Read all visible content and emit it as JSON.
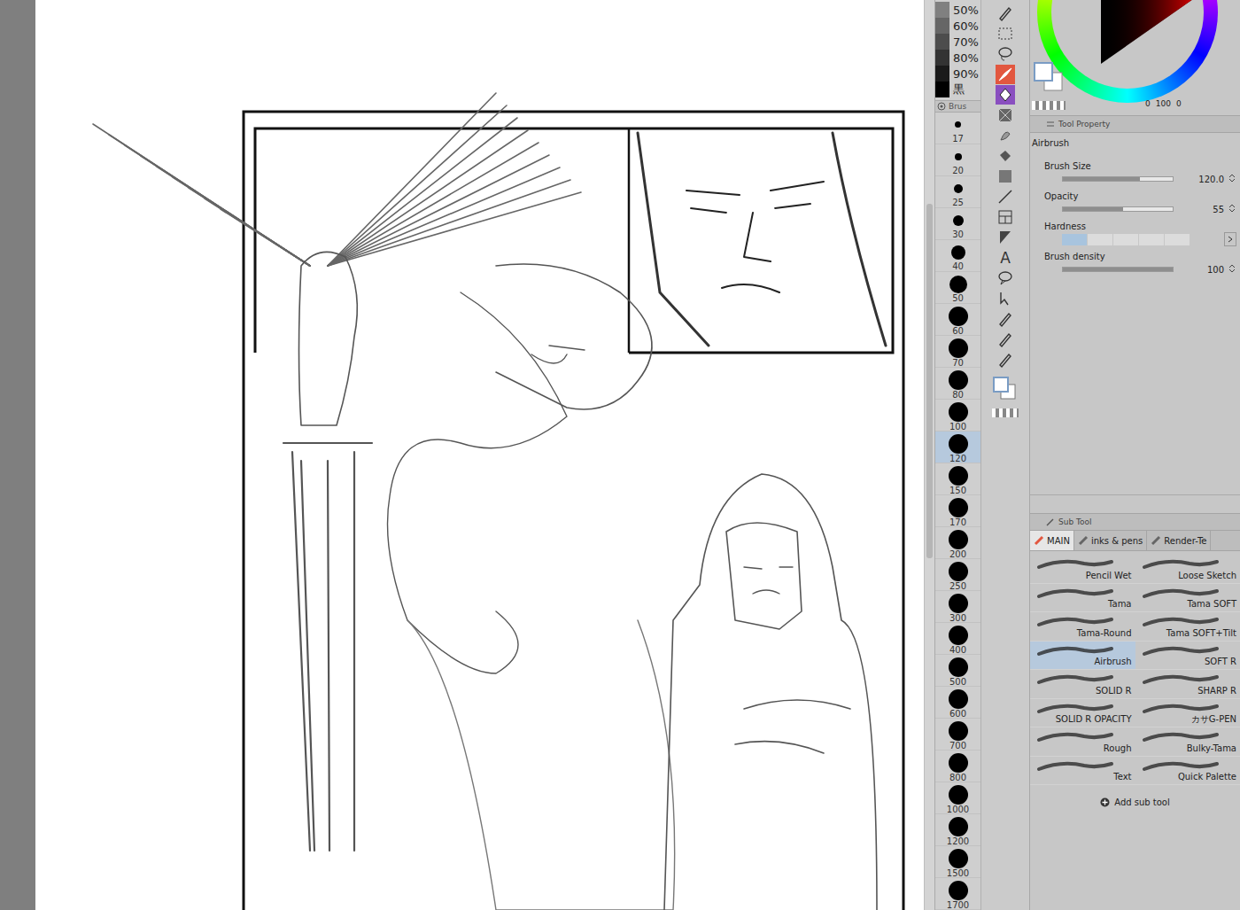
{
  "opacity_swatches": [
    {
      "label": "50%",
      "color": "#808080"
    },
    {
      "label": "60%",
      "color": "#666666"
    },
    {
      "label": "70%",
      "color": "#4d4d4d"
    },
    {
      "label": "80%",
      "color": "#333333"
    },
    {
      "label": "90%",
      "color": "#1a1a1a"
    },
    {
      "label": "黒",
      "color": "#000000"
    }
  ],
  "brush_size_palette": {
    "tab": "Brus",
    "sizes": [
      {
        "label": "17",
        "selected": false
      },
      {
        "label": "20",
        "selected": false
      },
      {
        "label": "25",
        "selected": false
      },
      {
        "label": "30",
        "selected": false
      },
      {
        "label": "40",
        "selected": false
      },
      {
        "label": "50",
        "selected": false
      },
      {
        "label": "60",
        "selected": false
      },
      {
        "label": "70",
        "selected": false
      },
      {
        "label": "80",
        "selected": false
      },
      {
        "label": "100",
        "selected": false
      },
      {
        "label": "120",
        "selected": true
      },
      {
        "label": "150",
        "selected": false
      },
      {
        "label": "170",
        "selected": false
      },
      {
        "label": "200",
        "selected": false
      },
      {
        "label": "250",
        "selected": false
      },
      {
        "label": "300",
        "selected": false
      },
      {
        "label": "400",
        "selected": false
      },
      {
        "label": "500",
        "selected": false
      },
      {
        "label": "600",
        "selected": false
      },
      {
        "label": "700",
        "selected": false
      },
      {
        "label": "800",
        "selected": false
      },
      {
        "label": "1000",
        "selected": false
      },
      {
        "label": "1200",
        "selected": false
      },
      {
        "label": "1500",
        "selected": false
      },
      {
        "label": "1700",
        "selected": false
      }
    ]
  },
  "tools": [
    {
      "kind": "pen",
      "selected": false
    },
    {
      "kind": "marquee",
      "selected": false
    },
    {
      "kind": "lasso",
      "selected": false
    },
    {
      "kind": "brush",
      "selected": true
    },
    {
      "kind": "decoration",
      "selected": false
    },
    {
      "kind": "pattern",
      "selected": false
    },
    {
      "kind": "blend",
      "selected": false
    },
    {
      "kind": "fill",
      "selected": false
    },
    {
      "kind": "gradient",
      "selected": false
    },
    {
      "kind": "line",
      "selected": false
    },
    {
      "kind": "frame",
      "selected": false
    },
    {
      "kind": "ruler",
      "selected": false
    },
    {
      "kind": "text",
      "selected": false,
      "glyph": "A"
    },
    {
      "kind": "balloon",
      "selected": false
    },
    {
      "kind": "object",
      "selected": false
    },
    {
      "kind": "pen",
      "selected": false
    },
    {
      "kind": "pen",
      "selected": false
    },
    {
      "kind": "pen",
      "selected": false
    }
  ],
  "color": {
    "readout": [
      "0",
      "100",
      "0"
    ]
  },
  "tool_property": {
    "tab": "Tool Property",
    "tool": "Airbrush",
    "properties": [
      {
        "label": "Brush Size",
        "kind": "slider",
        "value": "120.0",
        "level": 0.7
      },
      {
        "label": "Opacity",
        "kind": "slider",
        "value": "55",
        "level": 0.55
      },
      {
        "label": "Hardness",
        "kind": "steps",
        "level": 0.2
      },
      {
        "label": "Brush density",
        "kind": "slider",
        "value": "100",
        "level": 1
      }
    ]
  },
  "sub_tool": {
    "tab": "Sub Tool",
    "groups": [
      {
        "label": "MAIN",
        "selected": true
      },
      {
        "label": "inks & pens",
        "selected": false
      },
      {
        "label": "Render-Te",
        "selected": false
      }
    ],
    "brushes": [
      {
        "label": "Pencil Wet",
        "selected": false
      },
      {
        "label": "Loose Sketch",
        "selected": false
      },
      {
        "label": "Tama",
        "selected": false
      },
      {
        "label": "Tama SOFT",
        "selected": false
      },
      {
        "label": "Tama-Round",
        "selected": false
      },
      {
        "label": "Tama SOFT+Tilt",
        "selected": false
      },
      {
        "label": "Airbrush",
        "selected": true
      },
      {
        "label": "SOFT R",
        "selected": false
      },
      {
        "label": "SOLID R",
        "selected": false
      },
      {
        "label": "SHARP R",
        "selected": false
      },
      {
        "label": "SOLID R OPACITY",
        "selected": false
      },
      {
        "label": "カサG-PEN",
        "selected": false
      },
      {
        "label": "Rough",
        "selected": false
      },
      {
        "label": "Bulky-Tama",
        "selected": false
      },
      {
        "label": "Text",
        "selected": false
      },
      {
        "label": "Quick Palette",
        "selected": false
      }
    ],
    "add": "Add sub tool"
  }
}
